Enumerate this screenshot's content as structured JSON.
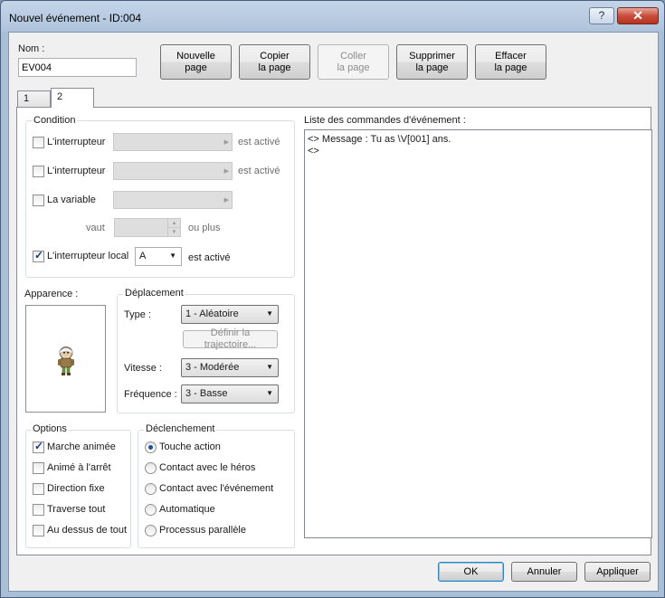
{
  "window": {
    "title": "Nouvel événement - ID:004",
    "help_label": "?",
    "close_label": "✕"
  },
  "name": {
    "label": "Nom :",
    "value": "EV004"
  },
  "toolbar": {
    "new_page": [
      "Nouvelle",
      "page"
    ],
    "copy_page": [
      "Copier",
      "la page"
    ],
    "paste_page": [
      "Coller",
      "la page"
    ],
    "delete_page": [
      "Supprimer",
      "la page"
    ],
    "clear_page": [
      "Effacer",
      "la page"
    ]
  },
  "tabs": [
    {
      "label": "1"
    },
    {
      "label": "2"
    }
  ],
  "condition": {
    "title": "Condition",
    "switch1_label": "L'interrupteur",
    "switch1_suffix": "est activé",
    "switch2_label": "L'interrupteur",
    "switch2_suffix": "est activé",
    "variable_label": "La variable",
    "vaut_label": "vaut",
    "ou_plus": "ou plus",
    "local_switch_label": "L'interrupteur local",
    "local_switch_value": "A",
    "local_switch_suffix": "est activé"
  },
  "apparence": {
    "title": "Apparence :"
  },
  "deplacement": {
    "title": "Déplacement",
    "type_label": "Type :",
    "type_value": "1 - Aléatoire",
    "define_route": "Définir la trajectoire...",
    "speed_label": "Vitesse :",
    "speed_value": "3 - Modérée",
    "freq_label": "Fréquence :",
    "freq_value": "3 - Basse"
  },
  "options": {
    "title": "Options",
    "items": [
      {
        "label": "Marche animée",
        "checked": true
      },
      {
        "label": "Animé à l'arrêt",
        "checked": false
      },
      {
        "label": "Direction fixe",
        "checked": false
      },
      {
        "label": "Traverse tout",
        "checked": false
      },
      {
        "label": "Au dessus de tout",
        "checked": false
      }
    ]
  },
  "declenchement": {
    "title": "Déclenchement",
    "items": [
      {
        "label": "Touche action",
        "checked": true
      },
      {
        "label": "Contact avec le héros",
        "checked": false
      },
      {
        "label": "Contact avec l'événement",
        "checked": false
      },
      {
        "label": "Automatique",
        "checked": false
      },
      {
        "label": "Processus parallèle",
        "checked": false
      }
    ]
  },
  "commands": {
    "title": "Liste des commandes d'événement :",
    "lines": [
      "<> Message : Tu as \\V[001] ans.",
      "<>"
    ]
  },
  "footer": {
    "ok": "OK",
    "cancel": "Annuler",
    "apply": "Appliquer"
  }
}
